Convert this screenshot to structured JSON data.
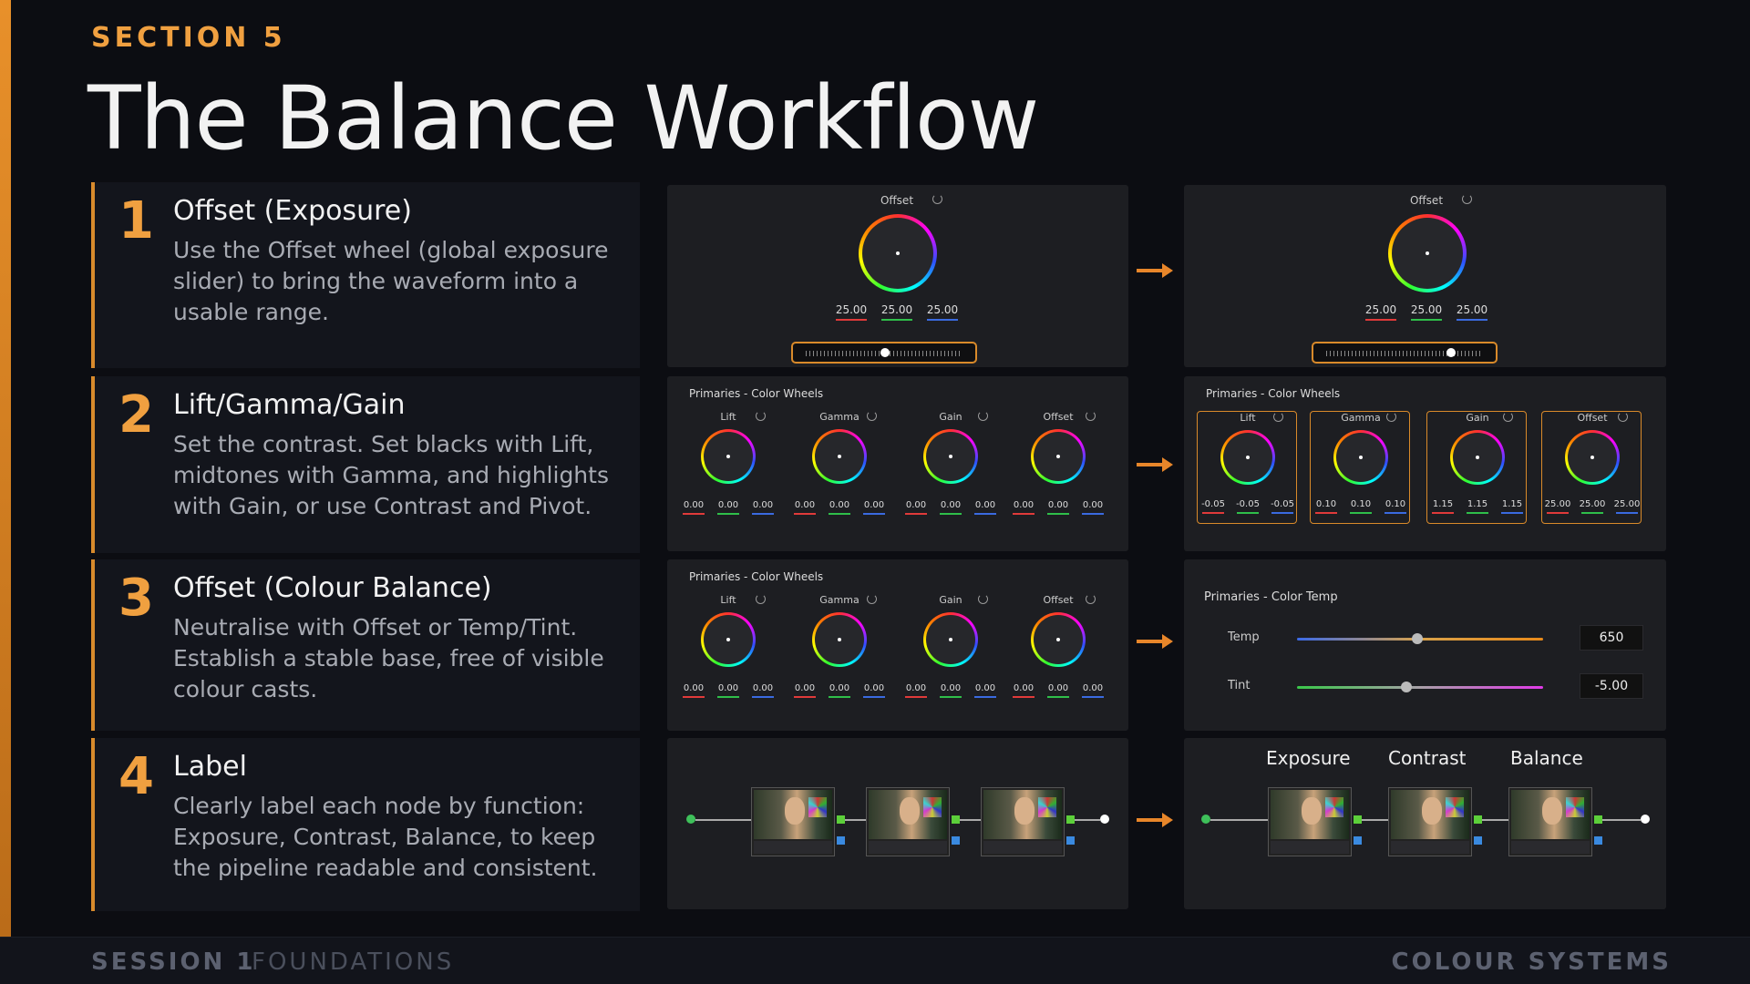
{
  "section_label": "SECTION 5",
  "title": "The Balance Workflow",
  "steps": [
    {
      "num": "1",
      "heading": "Offset (Exposure)",
      "body": "Use the Offset wheel (global exposure slider) to bring the waveform into a usable range."
    },
    {
      "num": "2",
      "heading": "Lift/Gamma/Gain",
      "body": "Set the contrast. Set blacks with Lift, midtones with Gamma, and highlights with Gain, or use Contrast and Pivot."
    },
    {
      "num": "3",
      "heading": "Offset (Colour Balance)",
      "body": "Neutralise with Offset or Temp/Tint. Establish a stable base, free of visible colour casts."
    },
    {
      "num": "4",
      "heading": "Label",
      "body": "Clearly label each node by function: Exposure, Contrast, Balance, to keep the pipeline readable and consistent."
    }
  ],
  "row1": {
    "before": {
      "label": "Offset",
      "values": [
        "25.00",
        "25.00",
        "25.00"
      ]
    },
    "after": {
      "label": "Offset",
      "values": [
        "25.00",
        "25.00",
        "25.00"
      ]
    }
  },
  "row2": {
    "title": "Primaries - Color Wheels",
    "before": [
      {
        "label": "Lift",
        "values": [
          "0.00",
          "0.00",
          "0.00"
        ]
      },
      {
        "label": "Gamma",
        "values": [
          "0.00",
          "0.00",
          "0.00"
        ]
      },
      {
        "label": "Gain",
        "values": [
          "0.00",
          "0.00",
          "0.00"
        ]
      },
      {
        "label": "Offset",
        "values": [
          "0.00",
          "0.00",
          "0.00"
        ]
      }
    ],
    "after": [
      {
        "label": "Lift",
        "values": [
          "-0.05",
          "-0.05",
          "-0.05"
        ]
      },
      {
        "label": "Gamma",
        "values": [
          "0.10",
          "0.10",
          "0.10"
        ]
      },
      {
        "label": "Gain",
        "values": [
          "1.15",
          "1.15",
          "1.15"
        ]
      },
      {
        "label": "Offset",
        "values": [
          "25.00",
          "25.00",
          "25.00"
        ]
      }
    ]
  },
  "row3": {
    "title": "Primaries - Color Wheels",
    "before": [
      {
        "label": "Lift",
        "values": [
          "0.00",
          "0.00",
          "0.00"
        ]
      },
      {
        "label": "Gamma",
        "values": [
          "0.00",
          "0.00",
          "0.00"
        ]
      },
      {
        "label": "Gain",
        "values": [
          "0.00",
          "0.00",
          "0.00"
        ]
      },
      {
        "label": "Offset",
        "values": [
          "0.00",
          "0.00",
          "0.00"
        ]
      }
    ],
    "after": {
      "title": "Primaries - Color Temp",
      "temp_label": "Temp",
      "temp_value": "650",
      "tint_label": "Tint",
      "tint_value": "-5.00"
    }
  },
  "row4": {
    "labels": [
      "Exposure",
      "Contrast",
      "Balance"
    ]
  },
  "footer": {
    "session": "SESSION 1",
    "topic": "FOUNDATIONS",
    "course": "COLOUR SYSTEMS"
  },
  "colors": {
    "accent": "#f0a040",
    "background": "#0c0d12",
    "panel": "#1d1e22"
  }
}
